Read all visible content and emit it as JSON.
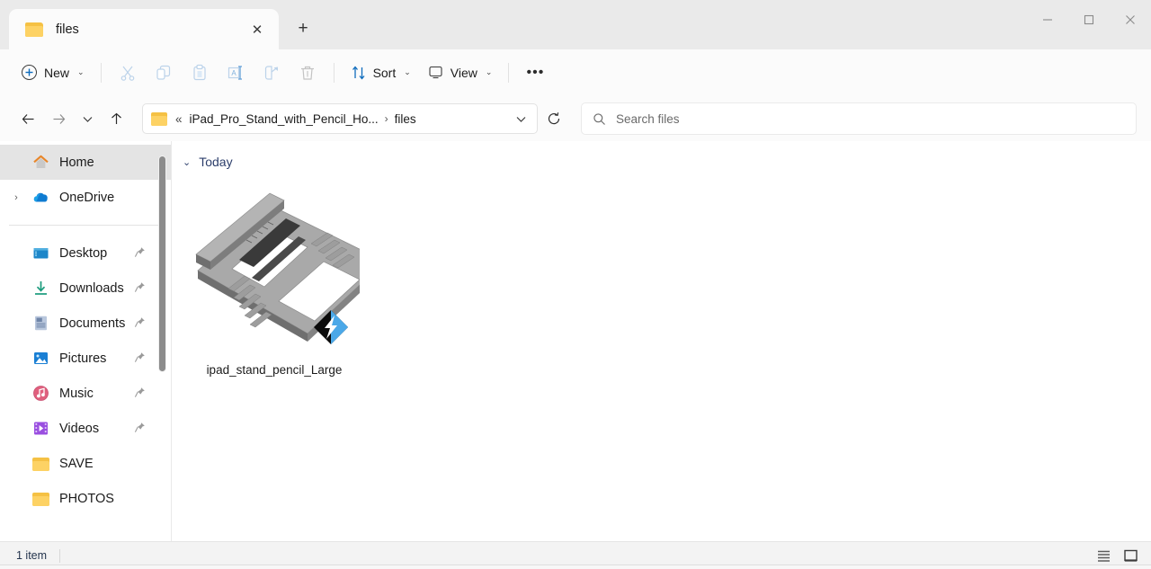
{
  "window": {
    "tab": {
      "title": "files",
      "icon": "folder-icon",
      "close_label": "✕"
    },
    "new_tab_label": "+",
    "controls": {
      "minimize": "─",
      "maximize": "□",
      "close": "✕"
    }
  },
  "toolbar": {
    "new_label": "New",
    "new_chevron": "⌄",
    "cut_label": "Cut",
    "copy_label": "Copy",
    "paste_label": "Paste",
    "rename_label": "Rename",
    "share_label": "Share",
    "delete_label": "Delete",
    "sort_label": "Sort",
    "sort_chevron": "⌄",
    "view_label": "View",
    "view_chevron": "⌄",
    "more_label": "•••"
  },
  "navbar": {
    "back": "←",
    "forward": "→",
    "recent_chevron": "⌄",
    "up": "↑",
    "breadcrumb": {
      "overflow": "«",
      "parent": "iPad_Pro_Stand_with_Pencil_Ho...",
      "separator": "›",
      "current": "files"
    },
    "dropdown_chevron": "⌄",
    "refresh_label": "Refresh"
  },
  "search": {
    "placeholder": "Search files",
    "icon": "search-icon"
  },
  "sidebar": {
    "items": [
      {
        "label": "Home",
        "icon": "home-icon",
        "selected": true,
        "pinned": false,
        "expander": false
      },
      {
        "label": "OneDrive",
        "icon": "onedrive-icon",
        "selected": false,
        "pinned": false,
        "expander": true
      },
      {
        "label": "Desktop",
        "icon": "desktop-icon",
        "selected": false,
        "pinned": true,
        "expander": false
      },
      {
        "label": "Downloads",
        "icon": "downloads-icon",
        "selected": false,
        "pinned": true,
        "expander": false
      },
      {
        "label": "Documents",
        "icon": "documents-icon",
        "selected": false,
        "pinned": true,
        "expander": false
      },
      {
        "label": "Pictures",
        "icon": "pictures-icon",
        "selected": false,
        "pinned": true,
        "expander": false
      },
      {
        "label": "Music",
        "icon": "music-icon",
        "selected": false,
        "pinned": true,
        "expander": false
      },
      {
        "label": "Videos",
        "icon": "videos-icon",
        "selected": false,
        "pinned": true,
        "expander": false
      },
      {
        "label": "SAVE",
        "icon": "folder-icon",
        "selected": false,
        "pinned": false,
        "expander": false
      },
      {
        "label": "PHOTOS",
        "icon": "folder-icon",
        "selected": false,
        "pinned": false,
        "expander": false
      }
    ],
    "expander_glyph": "›",
    "pin_glyph": "📌"
  },
  "main": {
    "group": {
      "chevron": "⌄",
      "label": "Today"
    },
    "files": [
      {
        "name": "ipad_stand_pencil_Large",
        "thumbnail": "3d-model-ipad-stand",
        "badge": "flashprint-icon"
      }
    ]
  },
  "statusbar": {
    "item_count": "1 item",
    "details_view_label": "Details view",
    "icons_view_label": "Large icons view"
  },
  "colors": {
    "accent": "#0f6cbd",
    "folder": "#f5c144",
    "selected_bg": "#e4e4e4",
    "group_text": "#2c3e6b"
  }
}
